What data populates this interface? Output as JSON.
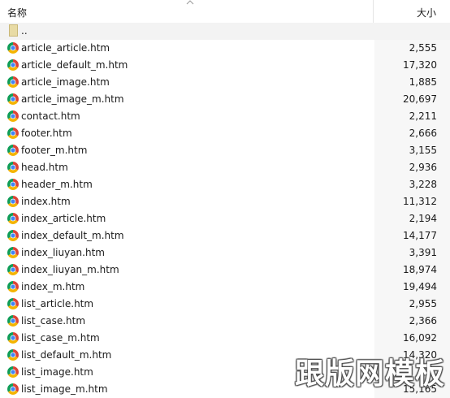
{
  "header": {
    "name_label": "名称",
    "size_label": "大小",
    "sort_icon": "chevron-up-icon"
  },
  "parent_row": {
    "name": ".."
  },
  "files": [
    {
      "name": "article_article.htm",
      "size": "2,555",
      "icon": "chrome-icon"
    },
    {
      "name": "article_default_m.htm",
      "size": "17,320",
      "icon": "chrome-icon"
    },
    {
      "name": "article_image.htm",
      "size": "1,885",
      "icon": "chrome-icon"
    },
    {
      "name": "article_image_m.htm",
      "size": "20,697",
      "icon": "chrome-icon"
    },
    {
      "name": "contact.htm",
      "size": "2,211",
      "icon": "chrome-icon"
    },
    {
      "name": "footer.htm",
      "size": "2,666",
      "icon": "chrome-icon"
    },
    {
      "name": "footer_m.htm",
      "size": "3,155",
      "icon": "chrome-icon"
    },
    {
      "name": "head.htm",
      "size": "2,936",
      "icon": "chrome-icon"
    },
    {
      "name": "header_m.htm",
      "size": "3,228",
      "icon": "chrome-icon"
    },
    {
      "name": "index.htm",
      "size": "11,312",
      "icon": "chrome-icon"
    },
    {
      "name": "index_article.htm",
      "size": "2,194",
      "icon": "chrome-icon"
    },
    {
      "name": "index_default_m.htm",
      "size": "14,177",
      "icon": "chrome-icon"
    },
    {
      "name": "index_liuyan.htm",
      "size": "3,391",
      "icon": "chrome-icon"
    },
    {
      "name": "index_liuyan_m.htm",
      "size": "18,974",
      "icon": "chrome-icon"
    },
    {
      "name": "index_m.htm",
      "size": "19,494",
      "icon": "chrome-icon"
    },
    {
      "name": "list_article.htm",
      "size": "2,955",
      "icon": "chrome-icon"
    },
    {
      "name": "list_case.htm",
      "size": "2,366",
      "icon": "chrome-icon"
    },
    {
      "name": "list_case_m.htm",
      "size": "16,092",
      "icon": "chrome-icon"
    },
    {
      "name": "list_default_m.htm",
      "size": "14,320",
      "icon": "chrome-icon"
    },
    {
      "name": "list_image.htm",
      "size": "",
      "icon": "chrome-icon"
    },
    {
      "name": "list_image_m.htm",
      "size": "15,165",
      "icon": "chrome-icon"
    }
  ],
  "watermark": "跟版网模板",
  "colors": {
    "chrome_red": "#db4437",
    "chrome_green": "#0f9d58",
    "chrome_yellow": "#f4b400",
    "chrome_blue": "#4285f4"
  }
}
